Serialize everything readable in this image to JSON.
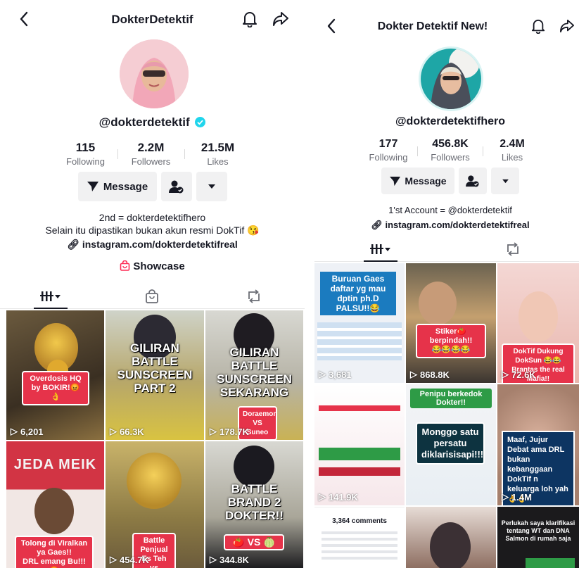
{
  "left": {
    "title": "DokterDetektif",
    "handle": "@dokterdetektif",
    "stats": [
      {
        "value": "115",
        "label": "Following"
      },
      {
        "value": "2.2M",
        "label": "Followers"
      },
      {
        "value": "21.5M",
        "label": "Likes"
      }
    ],
    "message_label": "Message",
    "bio_line1": "2nd = dokterdetektifhero",
    "bio_line2": "Selain itu dipastikan bukan akun resmi DokTif 😘",
    "link": "instagram.com/dokterdetektifreal",
    "showcase": "Showcase",
    "videos": [
      {
        "views": "6,201",
        "caption": "Overdosis HQ by BOKIR!😡👌"
      },
      {
        "views": "66.3K",
        "caption": "GILIRAN BATTLE SUNSCREEN PART 2"
      },
      {
        "views": "178.7K",
        "caption": "GILIRAN BATTLE SUNSCREEN SEKARANG",
        "sub": "Doraemon VS Suneo"
      },
      {
        "views": "",
        "caption": "Tolong di Viralkan ya Gaes!!",
        "sub": "DRL emang Bu!!!😡",
        "top": "JEDA MEIK"
      },
      {
        "views": "454.7K",
        "caption": "Battle Penjual Es Teh vs"
      },
      {
        "views": "344.8K",
        "caption": "BATTLE BRAND 2 DOKTER!!",
        "sub": "🍅 VS 🍈"
      }
    ]
  },
  "right": {
    "title": "Dokter Detektif New!",
    "handle": "@dokterdetektifhero",
    "stats": [
      {
        "value": "177",
        "label": "Following"
      },
      {
        "value": "456.8K",
        "label": "Followers"
      },
      {
        "value": "2.4M",
        "label": "Likes"
      }
    ],
    "message_label": "Message",
    "bio_line1": "1'st Account = @dokterdetektif",
    "link": "instagram.com/dokterdetektifreal",
    "videos": [
      {
        "views": "3,681",
        "caption": "Buruan Gaes daftar yg mau dptin ph.D PALSU!!😂"
      },
      {
        "views": "868.8K",
        "caption": "Stiker🍅 berpindah!!",
        "sub": "😂😂😂😂"
      },
      {
        "views": "72.6K",
        "caption": "DokTif Dukung DokSun 😂😂",
        "sub": "Brantas the real Mafia!!"
      },
      {
        "views": "141.9K",
        "caption": "",
        "top": ""
      },
      {
        "views": "",
        "caption": "Monggo satu persatu diklarisisapi!!!",
        "top": "Penipu berkedok Dokter!!"
      },
      {
        "views": "1.4M",
        "caption": "Maaf, Jujur Debat ama DRL bukan kebanggaan DokTif n keluarga loh yah 👌👌"
      },
      {
        "views": "",
        "caption": "3,364 comments"
      },
      {
        "views": "",
        "caption": ""
      },
      {
        "views": "",
        "caption": "Perlukah saya klarifikasi tentang WT dan DNA Salmon di rumah saja"
      }
    ]
  },
  "colors": {
    "accent": "#fe2c55",
    "verified": "#20d5ec",
    "text": "#161823",
    "muted": "#6b6d75"
  }
}
